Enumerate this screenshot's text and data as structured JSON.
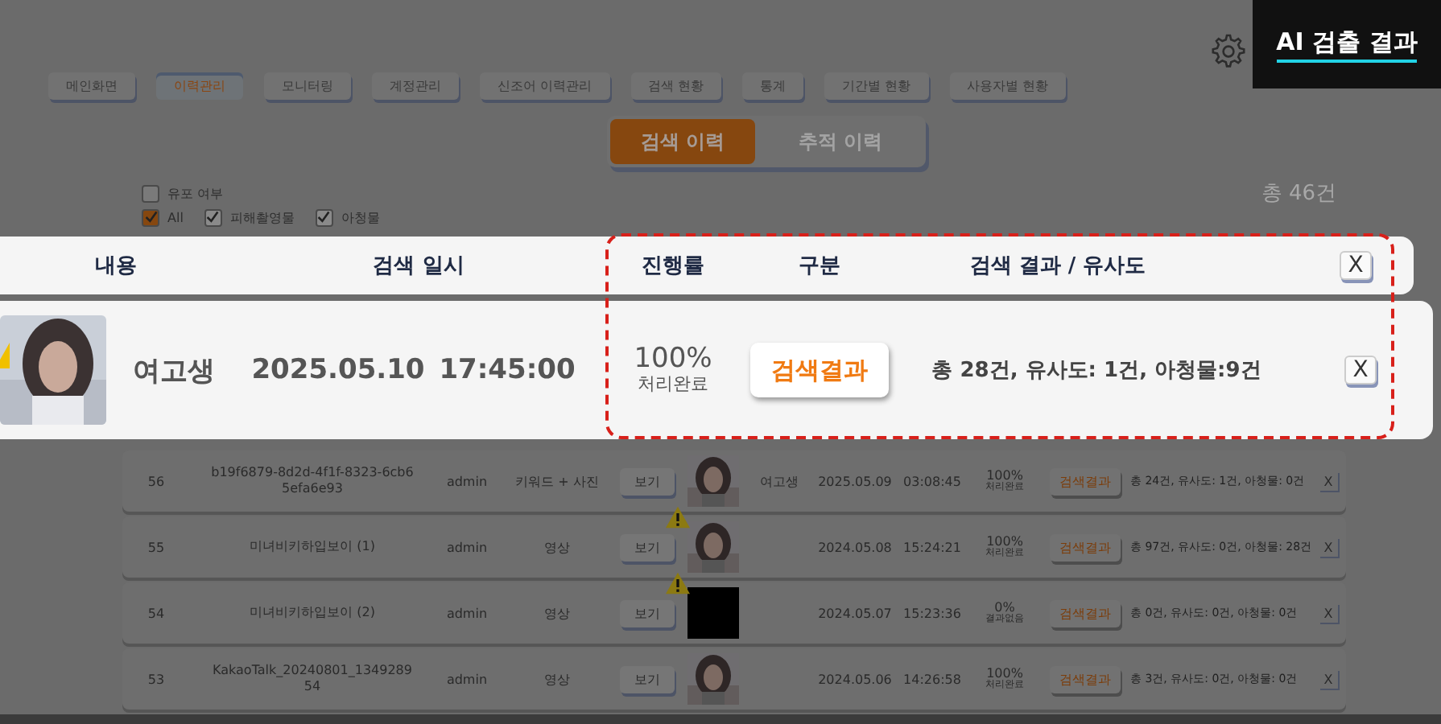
{
  "nav": {
    "tabs": [
      {
        "label": "메인화면",
        "selected": false
      },
      {
        "label": "이력관리",
        "selected": true
      },
      {
        "label": "모니터링",
        "selected": false
      },
      {
        "label": "계정관리",
        "selected": false
      },
      {
        "label": "신조어 이력관리",
        "selected": false
      },
      {
        "label": "검색 현황",
        "selected": false
      },
      {
        "label": "통계",
        "selected": false
      },
      {
        "label": "기간별 현황",
        "selected": false
      },
      {
        "label": "사용자별 현황",
        "selected": false
      }
    ]
  },
  "banner": {
    "title": "AI 검출 결과"
  },
  "view_toggle": [
    {
      "label": "검색 이력",
      "selected": true
    },
    {
      "label": "추적 이력",
      "selected": false
    }
  ],
  "filters": {
    "distribution": {
      "label": "유포 여부",
      "checked": false
    },
    "types": [
      {
        "label": "All",
        "checked": true
      },
      {
        "label": "피해촬영물",
        "checked": true
      },
      {
        "label": "아청물",
        "checked": true
      }
    ]
  },
  "total": "총 46건",
  "highlight": {
    "columns": [
      "내용",
      "검색 일시",
      "진행률",
      "구분",
      "검색 결과 / 유사도"
    ],
    "header_close": "X",
    "row": {
      "warning": true,
      "title": "여고생",
      "date": "2025.05.10",
      "time": "17:45:00",
      "progress": "100%",
      "progress_status": "처리완료",
      "result_button": "검색결과",
      "result": "총 28건, 유사도: 1건, 아청물:9건",
      "close": "X"
    }
  },
  "table": {
    "rows": [
      {
        "no": "56",
        "name": "b19f6879-8d2d-4f1f-8323-6cb65efa6e93",
        "user": "admin",
        "type": "키워드 + 사진",
        "view": "보기",
        "warning": false,
        "title": "여고생",
        "date": "2025.05.09",
        "time": "03:08:45",
        "progress": "100%",
        "progress_status": "처리완료",
        "result_button": "검색결과",
        "result": "총 24건, 유사도: 1건, 아청물: 0건",
        "close": "X"
      },
      {
        "no": "55",
        "name": "미녀비키하입보이 (1)",
        "user": "admin",
        "type": "영상",
        "view": "보기",
        "warning": true,
        "date": "2024.05.08",
        "time": "15:24:21",
        "progress": "100%",
        "progress_status": "처리완료",
        "result_button": "검색결과",
        "result": "총 97건, 유사도: 0건, 아청물: 28건",
        "close": "X"
      },
      {
        "no": "54",
        "name": "미녀비키하입보이 (2)",
        "user": "admin",
        "type": "영상",
        "view": "보기",
        "warning": true,
        "thumbnail": {
          "kind": "blank"
        },
        "date": "2024.05.07",
        "time": "15:23:36",
        "progress": "0%",
        "progress_status": "결과없음",
        "result_button": "검색결과",
        "result": "총 0건, 유사도: 0건, 아청물: 0건",
        "close": "X"
      },
      {
        "no": "53",
        "name": "KakaoTalk_20240801_134928954",
        "user": "admin",
        "type": "영상",
        "view": "보기",
        "warning": false,
        "date": "2024.05.06",
        "time": "14:26:58",
        "progress": "100%",
        "progress_status": "처리완료",
        "result_button": "검색결과",
        "result": "총 3건, 유사도: 0건, 아청물: 0건",
        "close": "X"
      }
    ]
  }
}
